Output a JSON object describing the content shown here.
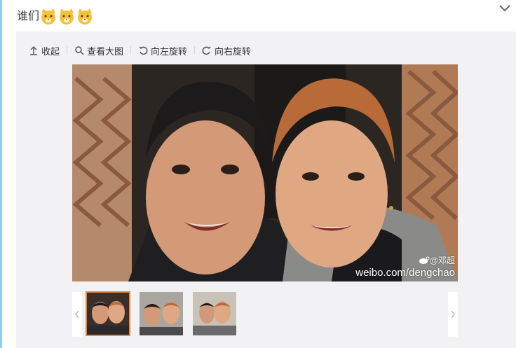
{
  "post": {
    "text": "谁们",
    "emoji_icon": "cat-face-emoji-icon",
    "emoji_count": 3
  },
  "toolbar": {
    "collapse_label": "收起",
    "view_large_label": "查看大图",
    "rotate_left_label": "向左旋转",
    "rotate_right_label": "向右旋转"
  },
  "photo": {
    "watermark_handle": "@邓超",
    "watermark_url": "weibo.com/dengchao"
  },
  "thumbnails": [
    {
      "label": "thumb-1",
      "selected": true
    },
    {
      "label": "thumb-2",
      "selected": false
    },
    {
      "label": "thumb-3",
      "selected": false
    }
  ],
  "colors": {
    "accent_selected": "#e8873d",
    "panel_bg": "#f2f2f5",
    "left_rule": "#8fcfe8"
  }
}
